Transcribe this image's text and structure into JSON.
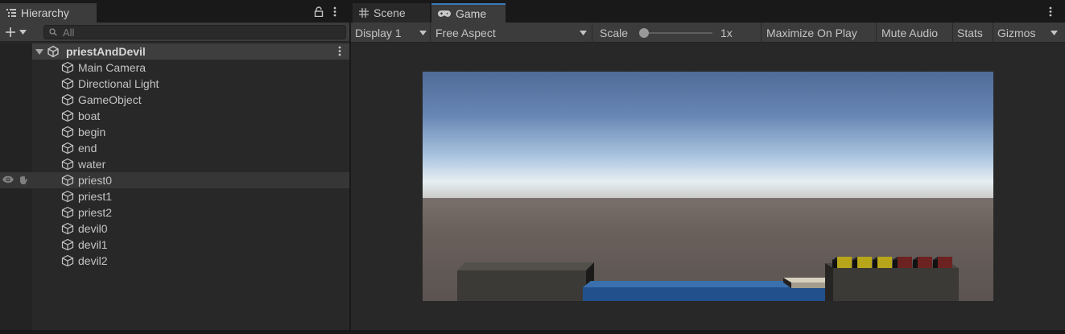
{
  "hierarchy": {
    "tab_label": "Hierarchy",
    "search_placeholder": "All",
    "scene_name": "priestAndDevil",
    "items": [
      "Main Camera",
      "Directional Light",
      "GameObject",
      "boat",
      "begin",
      "end",
      "water",
      "priest0",
      "priest1",
      "priest2",
      "devil0",
      "devil1",
      "devil2"
    ],
    "selected_item": "priest0"
  },
  "tabs": {
    "scene_label": "Scene",
    "game_label": "Game"
  },
  "game_toolbar": {
    "display": "Display 1",
    "aspect": "Free Aspect",
    "scale_label": "Scale",
    "scale_value": "1x",
    "scale_level": 0.0,
    "maximize_label": "Maximize On Play",
    "mute_label": "Mute Audio",
    "stats_label": "Stats",
    "gizmos_label": "Gizmos"
  },
  "icons": [
    "hierarchy-list-icon",
    "lock-icon",
    "kebab-menu-icon",
    "add-icon",
    "search-icon",
    "unity-scene-icon",
    "gameobject-cube-icon",
    "visibility-eye-icon",
    "pickable-hand-icon",
    "scene-grid-icon",
    "game-controller-icon",
    "dropdown-arrow-icon"
  ],
  "colors": {
    "accent": "#3a79bb",
    "panel": "#282828",
    "toolbar": "#3c3c3c",
    "water": "#2d5e9c",
    "priest": "#b7a61a",
    "devil": "#6c2220"
  }
}
